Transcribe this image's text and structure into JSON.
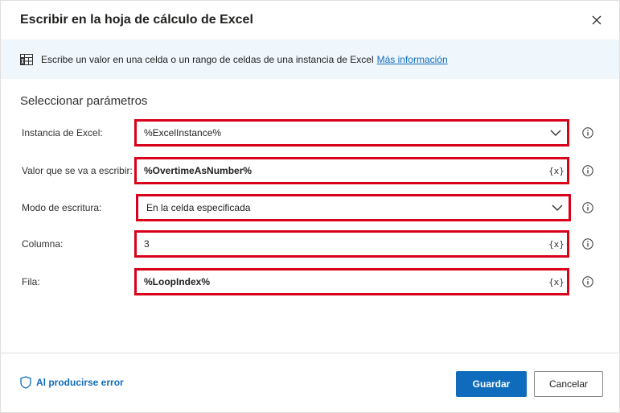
{
  "dialog": {
    "title": "Escribir en la hoja de cálculo de Excel",
    "close_icon": "close-icon"
  },
  "banner": {
    "icon": "excel-sheet-icon",
    "text": "Escribe un valor en una celda o un rango de celdas de una instancia de Excel",
    "link": "Más información"
  },
  "section": {
    "title": "Seleccionar parámetros"
  },
  "fields": [
    {
      "label": "Instancia de Excel:",
      "value": "%ExcelInstance%",
      "kind": "dropdown"
    },
    {
      "label": "Valor que se va a escribir:",
      "value": "%OvertimeAsNumber%",
      "kind": "variable",
      "var_button": "{x}"
    },
    {
      "label": "Modo de escritura:",
      "value": "En la celda especificada",
      "kind": "dropdown"
    },
    {
      "label": "Columna:",
      "value": "3",
      "kind": "variable",
      "var_button": "{x}"
    },
    {
      "label": "Fila:",
      "value": "%LoopIndex%",
      "kind": "variable",
      "var_button": "{x}"
    }
  ],
  "footer": {
    "on_error": "Al producirse error",
    "save": "Guardar",
    "cancel": "Cancelar"
  },
  "colors": {
    "accent": "#0f6cbd",
    "highlight_border": "#d9001b",
    "banner_bg": "#eff6fc"
  }
}
